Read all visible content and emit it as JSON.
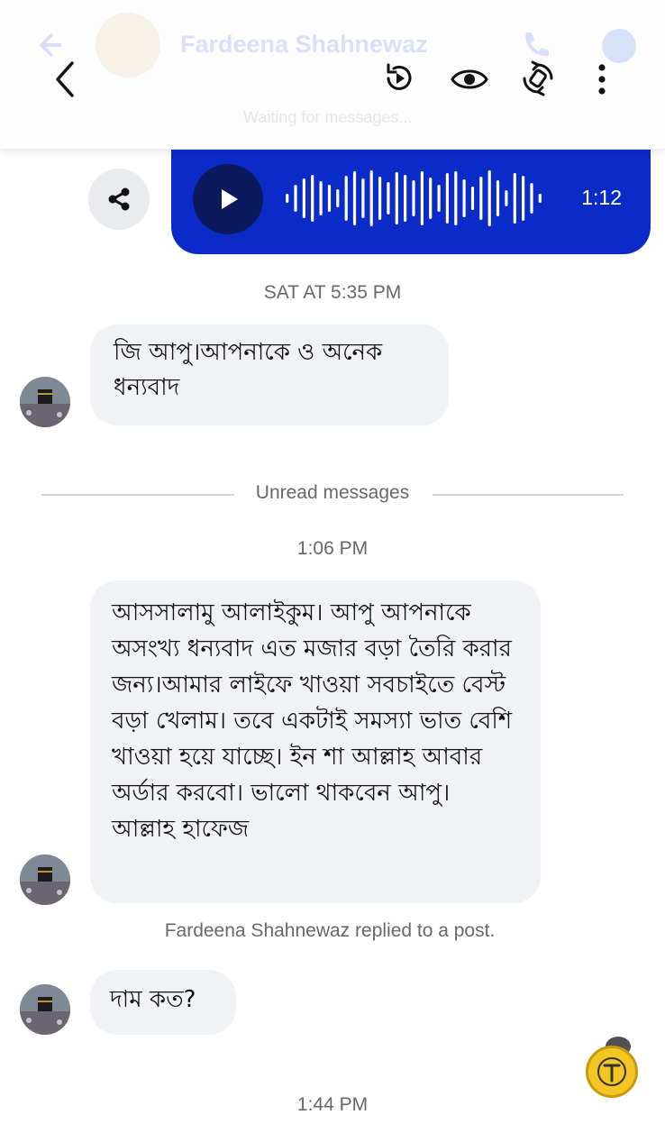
{
  "header": {
    "contact_name": "Fardeena Shahnewaz",
    "subtitle": "Waiting for messages...",
    "back_icon": "chevron-left-icon",
    "actions": [
      {
        "name": "replay-icon"
      },
      {
        "name": "eye-icon"
      },
      {
        "name": "rotate-icon"
      },
      {
        "name": "more-vertical-icon"
      }
    ]
  },
  "voice_message": {
    "duration": "1:12",
    "bubble_color": "#0a2bc8",
    "play_button_color": "#0a1a5c"
  },
  "messages": [
    {
      "timestamp": "SAT AT 5:35 PM",
      "text": "জি আপু।আপনাকে ও অনেক ধন্যবাদ"
    },
    {
      "timestamp": "1:06 PM",
      "text": "আসসালামু আলাইকুম। আপু আপনাকে অসংখ্য ধন্যবাদ এত মজার বড়া তৈরি করার জন্য।আমার লাইফে খাওয়া সবচাইতে বেস্ট বড়া খেলাম। তবে একটাই  সমস্যা ভাত বেশি খাওয়া হয়ে যাচ্ছে। ইন শা আল্লাহ আবার অর্ডার করবো। ভালো থাকবেন আপু। আল্লাহ হাফেজ"
    },
    {
      "reply_note": "Fardeena Shahnewaz replied to a post.",
      "text": "দাম কত?"
    }
  ],
  "unread_divider": "Unread messages",
  "last_timestamp": "1:44 PM",
  "colors": {
    "accent": "#0a2bc8",
    "incoming_bubble": "#f0f2f5",
    "meta_text": "#65686c"
  }
}
